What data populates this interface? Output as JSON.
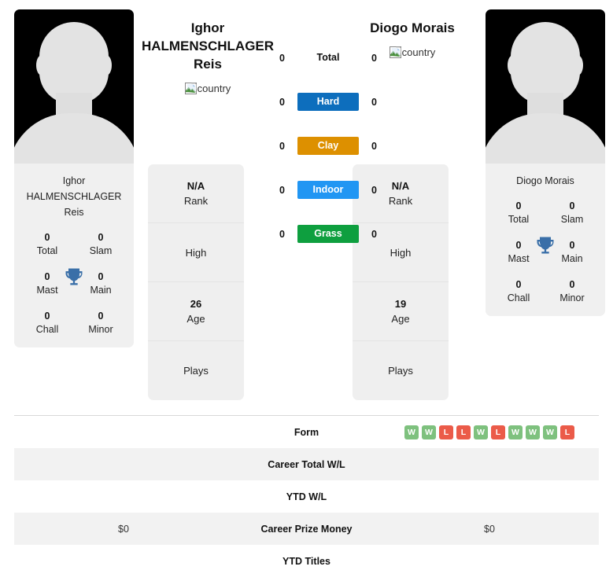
{
  "colors": {
    "hard": "#0d6ebd",
    "clay": "#dd9000",
    "indoor": "#2196f3",
    "grass": "#0e9f3f",
    "win": "#7ec17e",
    "loss": "#eb5b49",
    "trophy": "#3a6fa8",
    "row_shade": "#f2f2f2",
    "card_bg": "#efefef"
  },
  "players": {
    "left": {
      "display_name_lines": [
        "Ighor",
        "HALMENSCHLAGER",
        "Reis"
      ],
      "name_full": "Ighor HALMENSCHLAGER Reis",
      "flag_alt": "country",
      "card_name_lines": [
        "Ighor",
        "HALMENSCHLAGER",
        "Reis"
      ],
      "titles": [
        {
          "value": "0",
          "label": "Total"
        },
        {
          "value": "0",
          "label": "Slam"
        },
        {
          "value": "0",
          "label": "Mast"
        },
        {
          "value": "0",
          "label": "Main"
        },
        {
          "value": "0",
          "label": "Chall"
        },
        {
          "value": "0",
          "label": "Minor"
        }
      ],
      "stats": [
        {
          "value": "N/A",
          "label": "Rank"
        },
        {
          "value": "",
          "label": "High"
        },
        {
          "value": "26",
          "label": "Age"
        },
        {
          "value": "",
          "label": "Plays"
        }
      ]
    },
    "right": {
      "display_name_lines": [
        "Diogo Morais"
      ],
      "name_full": "Diogo Morais",
      "flag_alt": "country",
      "card_name_lines": [
        "Diogo Morais"
      ],
      "titles": [
        {
          "value": "0",
          "label": "Total"
        },
        {
          "value": "0",
          "label": "Slam"
        },
        {
          "value": "0",
          "label": "Mast"
        },
        {
          "value": "0",
          "label": "Main"
        },
        {
          "value": "0",
          "label": "Chall"
        },
        {
          "value": "0",
          "label": "Minor"
        }
      ],
      "stats": [
        {
          "value": "N/A",
          "label": "Rank"
        },
        {
          "value": "",
          "label": "High"
        },
        {
          "value": "19",
          "label": "Age"
        },
        {
          "value": "",
          "label": "Plays"
        }
      ]
    }
  },
  "surfaces": [
    {
      "label": "Total",
      "left": "0",
      "right": "0",
      "style": "plain"
    },
    {
      "label": "Hard",
      "left": "0",
      "right": "0",
      "style": "hard"
    },
    {
      "label": "Clay",
      "left": "0",
      "right": "0",
      "style": "clay"
    },
    {
      "label": "Indoor",
      "left": "0",
      "right": "0",
      "style": "indoor"
    },
    {
      "label": "Grass",
      "left": "0",
      "right": "0",
      "style": "grass"
    }
  ],
  "table": {
    "rows": [
      {
        "label": "Form",
        "left": "",
        "right": "",
        "shaded": false,
        "right_form": [
          "W",
          "W",
          "L",
          "L",
          "W",
          "L",
          "W",
          "W",
          "W",
          "L"
        ]
      },
      {
        "label": "Career Total W/L",
        "left": "",
        "right": "",
        "shaded": true
      },
      {
        "label": "YTD W/L",
        "left": "",
        "right": "",
        "shaded": false
      },
      {
        "label": "Career Prize Money",
        "left": "$0",
        "right": "$0",
        "shaded": true
      },
      {
        "label": "YTD Titles",
        "left": "",
        "right": "",
        "shaded": false
      }
    ]
  }
}
